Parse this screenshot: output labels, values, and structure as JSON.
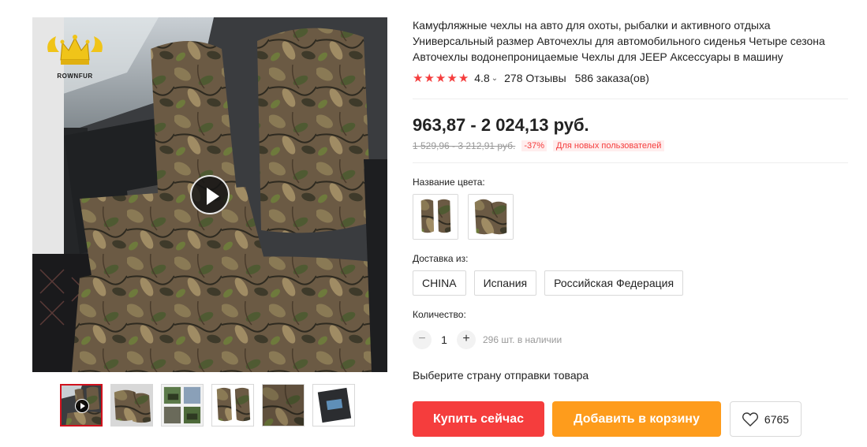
{
  "gallery": {
    "brand_logo_text": "ROWNFUR",
    "play_icon": "play-icon",
    "thumbnail_count": 6,
    "active_thumbnail": 1
  },
  "product": {
    "title": "Камуфляжные чехлы на авто для охоты, рыбалки и активного отдыха Универсальный размер Авточехлы для автомобильного сиденья Четыре сезона Авточехлы водонепроницаемые Чехлы для JEEP Аксессуары в машину",
    "rating": "4.8",
    "reviews": "278 Отзывы",
    "orders": "586 заказа(ов)",
    "price": "963,87 - 2 024,13 руб.",
    "old_price": "1 529,96 - 3 212,91 руб.",
    "discount": "-37%",
    "new_users_badge": "Для новых пользователей"
  },
  "options": {
    "color_label": "Название цвета:",
    "ship_from_label": "Доставка из:",
    "ship_from": [
      "CHINA",
      "Испания",
      "Российская Федерация"
    ],
    "quantity_label": "Количество:",
    "quantity": "1",
    "minus": "−",
    "plus": "+",
    "stock": "296 шт. в наличии",
    "ship_note": "Выберите страну отправки товара"
  },
  "actions": {
    "buy_now": "Купить сейчас",
    "add_to_cart": "Добавить в корзину",
    "wishlist_count": "6765"
  },
  "colors": {
    "accent_red": "#f53d3d",
    "accent_orange": "#fe9c1c",
    "star": "#f53d3d",
    "active_thumb_border": "#d0111d"
  }
}
